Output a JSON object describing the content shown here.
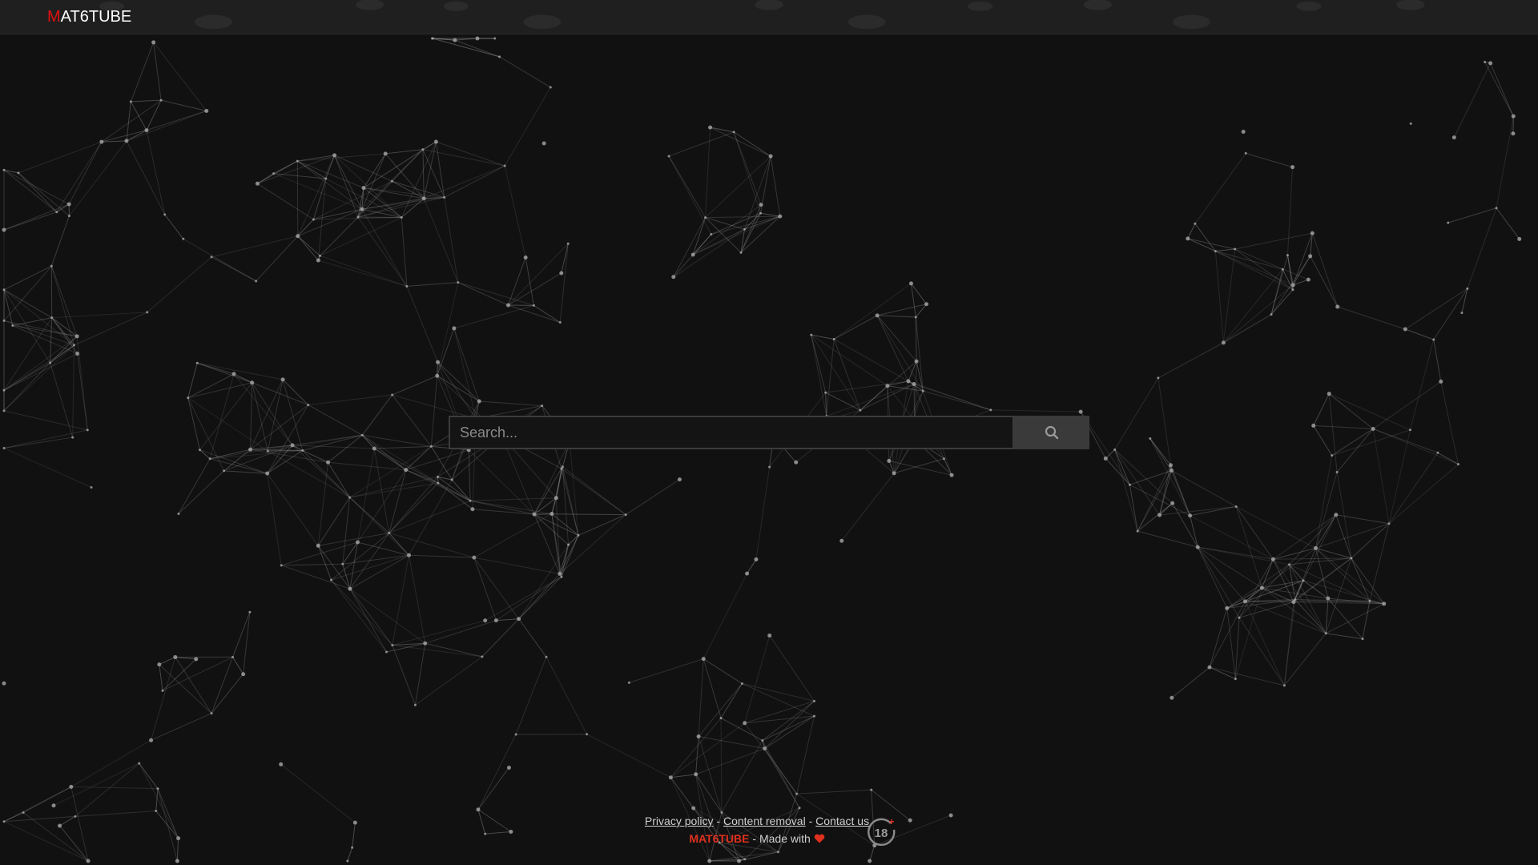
{
  "header": {
    "logo_first": "M",
    "logo_rest": "AT6TUBE"
  },
  "search": {
    "placeholder": "Search...",
    "value": ""
  },
  "footer": {
    "privacy_label": "Privacy policy",
    "separator": "-",
    "content_removal_label": "Content removal",
    "contact_label": "Contact us",
    "brand": "MAT6TUBE",
    "made_with": "- Made with"
  },
  "age_badge": {
    "label": "18",
    "plus": "+"
  },
  "colors": {
    "background": "#111111",
    "topbar": "#1f1f1f",
    "accent_red": "#e01010",
    "search_button": "#3a3a3a"
  },
  "icons": {
    "search": "search-icon",
    "heart": "heart-icon",
    "age": "age-18-plus-icon"
  }
}
